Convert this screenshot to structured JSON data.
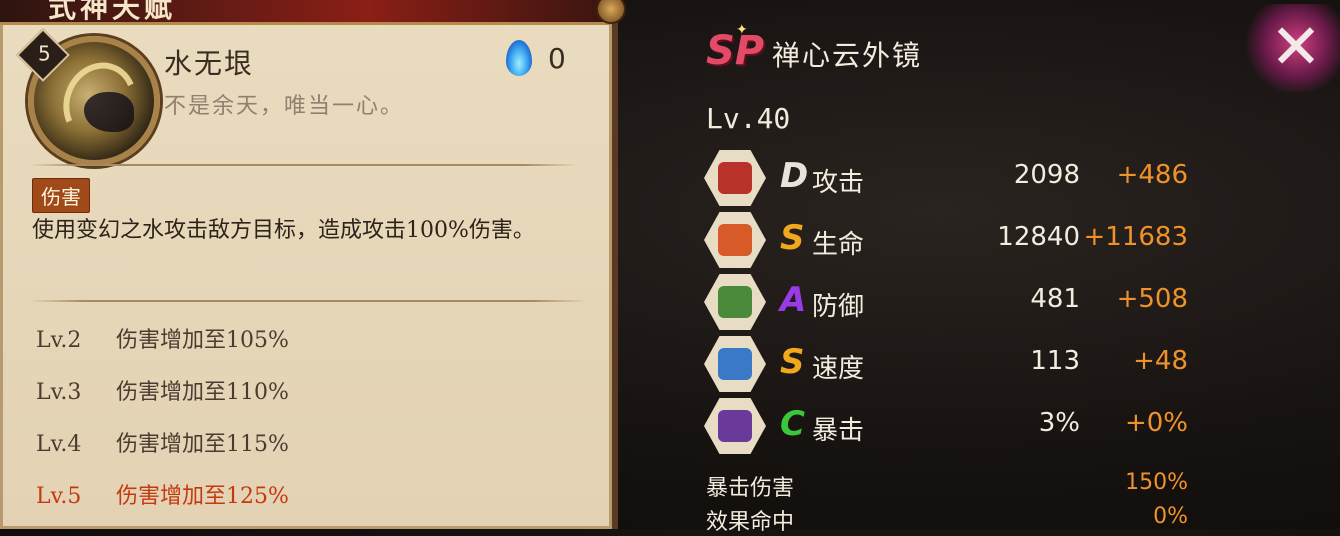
{
  "skill_card": {
    "banner": "式神天赋",
    "level": "5",
    "name": "水无垠",
    "quote": "不是余天，唯当一心。",
    "orb_value": "0",
    "tag": "伤害",
    "description": "使用变幻之水攻击敌方目标，造成攻击100%伤害。",
    "levels": [
      {
        "lv": "Lv.2",
        "text": "伤害增加至105%",
        "active": false
      },
      {
        "lv": "Lv.3",
        "text": "伤害增加至110%",
        "active": false
      },
      {
        "lv": "Lv.4",
        "text": "伤害增加至115%",
        "active": false
      },
      {
        "lv": "Lv.5",
        "text": "伤害增加至125%",
        "active": true
      }
    ]
  },
  "shikigami": {
    "rarity": "SP",
    "name": "禅心云外镜",
    "level_label": "Lv.40",
    "stats": [
      {
        "grade": "D",
        "grade_color": "#e8e4dc",
        "name": "攻击",
        "base": "2098",
        "bonus": "+486",
        "icon": "attack-icon",
        "icon_color": "#b8322a"
      },
      {
        "grade": "S",
        "grade_color": "#f2a81c",
        "name": "生命",
        "base": "12840",
        "bonus": "+11683",
        "icon": "health-icon",
        "icon_color": "#d85a28"
      },
      {
        "grade": "A",
        "grade_color": "#9a3ae8",
        "name": "防御",
        "base": "481",
        "bonus": "+508",
        "icon": "defense-icon",
        "icon_color": "#4a8a3a"
      },
      {
        "grade": "S",
        "grade_color": "#f2a81c",
        "name": "速度",
        "base": "113",
        "bonus": "+48",
        "icon": "speed-icon",
        "icon_color": "#3a78c8"
      },
      {
        "grade": "C",
        "grade_color": "#3ac83a",
        "name": "暴击",
        "base": "3%",
        "bonus": "+0%",
        "icon": "crit-icon",
        "icon_color": "#6a3a9a"
      }
    ],
    "extra": [
      {
        "name": "暴击伤害",
        "value": "150%"
      },
      {
        "name": "效果命中",
        "value": "0%"
      }
    ]
  },
  "close_label": "✕"
}
